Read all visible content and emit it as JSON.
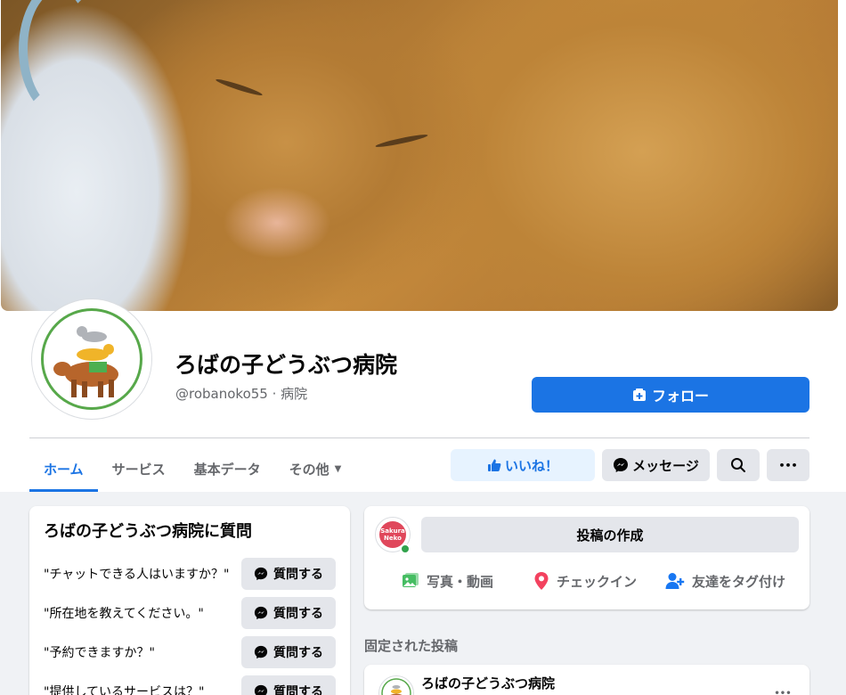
{
  "page": {
    "name": "ろばの子どうぶつ病院",
    "meta": "@robanoko55 · 病院",
    "follow_label": "フォロー"
  },
  "tabs": [
    {
      "label": "ホーム",
      "active": true
    },
    {
      "label": "サービス",
      "active": false
    },
    {
      "label": "基本データ",
      "active": false
    },
    {
      "label": "その他",
      "active": false
    }
  ],
  "actions": {
    "like_label": "いいね！",
    "message_label": "メッセージ",
    "more_label": "•••"
  },
  "questions": {
    "title": "ろばの子どうぶつ病院に質問",
    "ask_label": "質問する",
    "items": [
      "\"チャットできる人はいますか？\"",
      "\"所在地を教えてください。\"",
      "\"予約できますか？\"",
      "\"提供しているサービスは？\""
    ]
  },
  "composer": {
    "create_post_label": "投稿の作成",
    "avatar_text": "Sakura Neko",
    "photo_video_label": "写真・動画",
    "checkin_label": "チェックイン",
    "tag_friends_label": "友達をタグ付け"
  },
  "pinned": {
    "label": "固定された投稿",
    "post_author": "ろばの子どうぶつ病院",
    "more_label": "•••"
  },
  "colors": {
    "primary": "#1b74e4",
    "like_bg": "#e7f3ff",
    "secondary_btn": "#e4e6eb",
    "background": "#f0f2f5",
    "photo_icon": "#45bd62",
    "checkin_icon": "#f3425f",
    "tag_icon": "#1877f2",
    "online": "#31a24c"
  },
  "icons": {
    "follow": "page-plus-icon",
    "like": "thumbs-up-icon",
    "message": "messenger-icon",
    "search": "search-icon",
    "more": "more-dots-icon",
    "photo": "photo-video-icon",
    "checkin": "location-pin-icon",
    "tag": "tag-friends-icon",
    "caret": "caret-down-icon"
  }
}
